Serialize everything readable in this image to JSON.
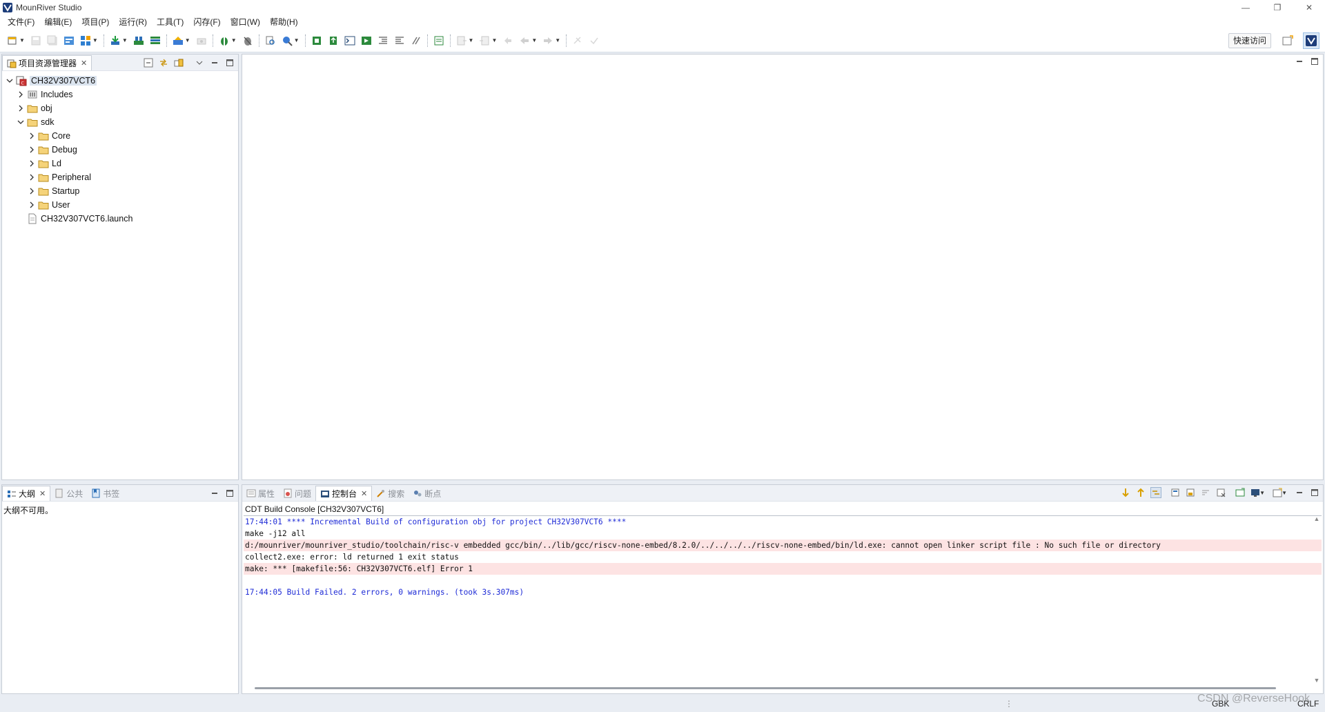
{
  "window": {
    "title": "MounRiver Studio",
    "controls": [
      "—",
      "❐",
      "✕"
    ]
  },
  "menu": [
    "文件(F)",
    "编辑(E)",
    "项目(P)",
    "运行(R)",
    "工具(T)",
    "闪存(F)",
    "窗口(W)",
    "帮助(H)"
  ],
  "toolbar": {
    "quick_access": "快速访问"
  },
  "project_explorer": {
    "tab_label": "项目资源管理器",
    "tree": [
      {
        "label": "CH32V307VCT6",
        "depth": 0,
        "expanded": true,
        "icon": "project-icon",
        "selected": true
      },
      {
        "label": "Includes",
        "depth": 1,
        "expanded": false,
        "icon": "includes-icon"
      },
      {
        "label": "obj",
        "depth": 1,
        "expanded": false,
        "icon": "folder-icon"
      },
      {
        "label": "sdk",
        "depth": 1,
        "expanded": true,
        "icon": "folder-icon"
      },
      {
        "label": "Core",
        "depth": 2,
        "expanded": false,
        "icon": "folder-icon"
      },
      {
        "label": "Debug",
        "depth": 2,
        "expanded": false,
        "icon": "folder-icon"
      },
      {
        "label": "Ld",
        "depth": 2,
        "expanded": false,
        "icon": "folder-icon"
      },
      {
        "label": "Peripheral",
        "depth": 2,
        "expanded": false,
        "icon": "folder-icon"
      },
      {
        "label": "Startup",
        "depth": 2,
        "expanded": false,
        "icon": "folder-icon"
      },
      {
        "label": "User",
        "depth": 2,
        "expanded": false,
        "icon": "folder-icon"
      },
      {
        "label": "CH32V307VCT6.launch",
        "depth": 1,
        "expanded": null,
        "icon": "launch-file-icon"
      }
    ]
  },
  "outline": {
    "tabs": [
      {
        "label": "大纲",
        "active": true,
        "closable": true
      },
      {
        "label": "公共",
        "active": false
      },
      {
        "label": "书签",
        "active": false
      }
    ],
    "message": "大纲不可用。"
  },
  "bottom_panel": {
    "tabs": [
      {
        "label": "属性",
        "active": false
      },
      {
        "label": "问题",
        "active": false
      },
      {
        "label": "控制台",
        "active": true,
        "closable": true
      },
      {
        "label": "搜索",
        "active": false
      },
      {
        "label": "断点",
        "active": false
      }
    ],
    "console_title": "CDT Build Console [CH32V307VCT6]",
    "lines": [
      {
        "text": "17:44:01 **** Incremental Build of configuration obj for project CH32V307VCT6 ****",
        "style": "blue"
      },
      {
        "text": "make -j12 all",
        "style": "black"
      },
      {
        "text": "d:/mounriver/mounriver_studio/toolchain/risc-v embedded gcc/bin/../lib/gcc/riscv-none-embed/8.2.0/../../../../riscv-none-embed/bin/ld.exe: cannot open linker script file : No such file or directory",
        "style": "error"
      },
      {
        "text": "collect2.exe: error: ld returned 1 exit status",
        "style": "black"
      },
      {
        "text": "make: *** [makefile:56: CH32V307VCT6.elf] Error 1",
        "style": "error"
      },
      {
        "text": "",
        "style": "black"
      },
      {
        "text": "17:44:05 Build Failed. 2 errors, 0 warnings. (took 3s.307ms)",
        "style": "blue"
      }
    ]
  },
  "statusbar": {
    "encoding": "GBK",
    "line_ending": "CRLF"
  },
  "watermark": "CSDN @ReverseHook"
}
